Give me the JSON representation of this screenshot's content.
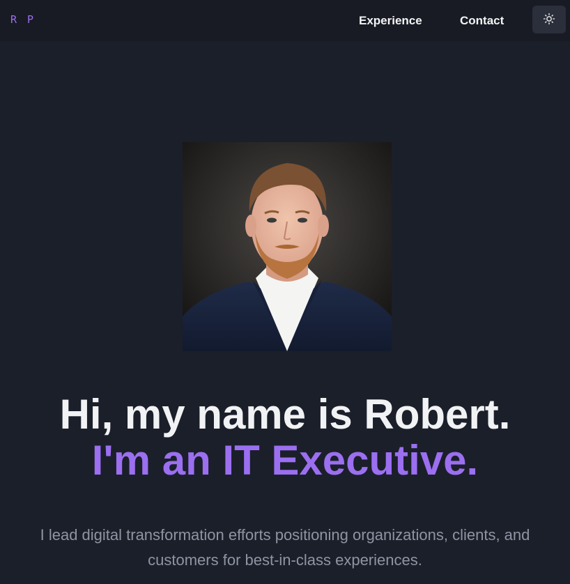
{
  "nav": {
    "logo": "R P",
    "links": [
      {
        "label": "Experience"
      },
      {
        "label": "Contact"
      }
    ],
    "theme_toggle_icon": "sun-icon"
  },
  "hero": {
    "portrait_alt": "Robert portrait",
    "greeting": "Hi, my name is Robert.",
    "role_line": "I'm an IT Executive.",
    "tagline": "I lead digital transformation efforts positioning organizations, clients, and customers for best-in-class experiences."
  },
  "colors": {
    "background": "#1b1f2a",
    "navbar": "#181b23",
    "accent": "#9b6ff0",
    "heading": "#f1f2f4",
    "muted_text": "#8f94a3",
    "button_bg": "#2b2f3b"
  }
}
